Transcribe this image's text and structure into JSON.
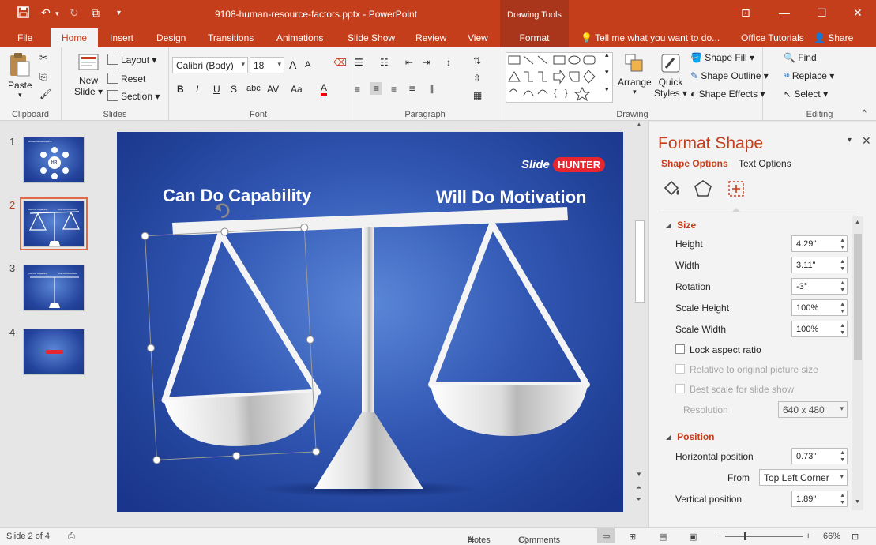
{
  "window": {
    "title": "9108-human-resource-factors.pptx - PowerPoint",
    "contextual_header": "Drawing Tools"
  },
  "tabs": {
    "file": "File",
    "home": "Home",
    "insert": "Insert",
    "design": "Design",
    "transitions": "Transitions",
    "animations": "Animations",
    "slideshow": "Slide Show",
    "review": "Review",
    "view": "View",
    "format": "Format",
    "tell_me": "Tell me what you want to do...",
    "office_tutorials": "Office Tutorials",
    "share": "Share"
  },
  "ribbon": {
    "clipboard": {
      "label": "Clipboard",
      "paste": "Paste"
    },
    "slides": {
      "label": "Slides",
      "new_slide_1": "New",
      "new_slide_2": "Slide",
      "layout": "Layout",
      "reset": "Reset",
      "section": "Section"
    },
    "font": {
      "label": "Font",
      "family": "Calibri (Body)",
      "size": "18",
      "bold": "B",
      "italic": "I",
      "underline": "U",
      "shadow": "S",
      "strike": "abc",
      "spacing": "AV",
      "case": "Aa",
      "color": "A",
      "grow": "A",
      "shrink": "A"
    },
    "paragraph": {
      "label": "Paragraph"
    },
    "drawing": {
      "label": "Drawing",
      "arrange": "Arrange",
      "quick_styles_1": "Quick",
      "quick_styles_2": "Styles",
      "shape_fill": "Shape Fill",
      "shape_outline": "Shape Outline",
      "shape_effects": "Shape Effects"
    },
    "editing": {
      "label": "Editing",
      "find": "Find",
      "replace": "Replace",
      "select": "Select"
    }
  },
  "thumbnails": [
    {
      "num": "1",
      "title": "Human Resource ROI",
      "center": "HR"
    },
    {
      "num": "2",
      "left": "Can Do Capability",
      "right": "Will Do Motivation"
    },
    {
      "num": "3",
      "left": "Can Do Capability",
      "right": "Will Do Motivation"
    },
    {
      "num": "4"
    }
  ],
  "slide": {
    "left_title": "Can Do Capability",
    "right_title": "Will Do Motivation",
    "logo_slide": "Slide",
    "logo_hunter": "HUNTER"
  },
  "format_pane": {
    "title": "Format Shape",
    "tab_shape": "Shape Options",
    "tab_text": "Text Options",
    "size_section": "Size",
    "height_label": "Height",
    "height": "4.29\"",
    "width_label": "Width",
    "width": "3.11\"",
    "rotation_label": "Rotation",
    "rotation": "-3°",
    "scale_h_label": "Scale Height",
    "scale_h": "100%",
    "scale_w_label": "Scale Width",
    "scale_w": "100%",
    "lock_aspect": "Lock aspect ratio",
    "relative_orig": "Relative to original picture size",
    "best_scale": "Best scale for slide show",
    "resolution_label": "Resolution",
    "resolution": "640 x 480",
    "position_section": "Position",
    "hpos_label": "Horizontal position",
    "hpos": "0.73\"",
    "from_label": "From",
    "from": "Top Left Corner",
    "vpos_label": "Vertical position",
    "vpos": "1.89\""
  },
  "status": {
    "slide_info": "Slide 2 of 4",
    "notes": "Notes",
    "comments": "Comments",
    "zoom": "66%"
  },
  "colors": {
    "accent": "#c43e1c",
    "slide_bg": "#2d52ad"
  }
}
